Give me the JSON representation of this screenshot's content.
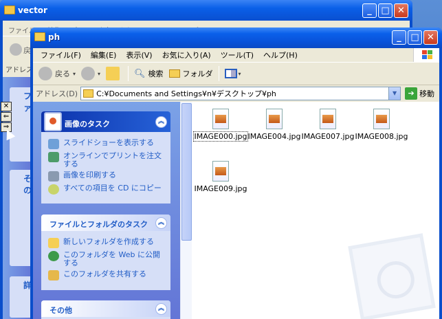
{
  "back_window": {
    "title": "vector",
    "menu_text": "ファイル(F)   編集(E)   表示(V)   お気に入り(A)   ツール(T)   ヘルプ(H)",
    "toolbar_back": "戻",
    "address_label": "アドレス",
    "panel_labels": [
      "ファ",
      "その",
      "詳"
    ]
  },
  "window": {
    "title": "ph",
    "menu": [
      "ファイル(F)",
      "編集(E)",
      "表示(V)",
      "お気に入り(A)",
      "ツール(T)",
      "ヘルプ(H)"
    ],
    "toolbar": {
      "back": "戻る",
      "search": "検索",
      "folders": "フォルダ"
    },
    "address": {
      "label": "アドレス(D)",
      "path": "C:¥Documents and Settings¥n¥デスクトップ¥ph",
      "go": "移動"
    },
    "tasks": {
      "image_tasks": {
        "title": "画像のタスク",
        "items": [
          "スライドショーを表示する",
          "オンラインでプリントを注文する",
          "画像を印刷する",
          "すべての項目を CD にコピー"
        ]
      },
      "file_tasks": {
        "title": "ファイルとフォルダのタスク",
        "items": [
          "新しいフォルダを作成する",
          "このフォルダを Web に公開する",
          "このフォルダを共有する"
        ]
      },
      "other": {
        "title": "その他"
      }
    },
    "files": [
      "IMAGE000.jpg",
      "IMAGE004.jpg",
      "IMAGE007.jpg",
      "IMAGE008.jpg",
      "IMAGE009.jpg"
    ]
  },
  "colors": {
    "titlebar": "#0a5fe8",
    "taskpane": "#7ba2e7",
    "link": "#215dc6"
  }
}
